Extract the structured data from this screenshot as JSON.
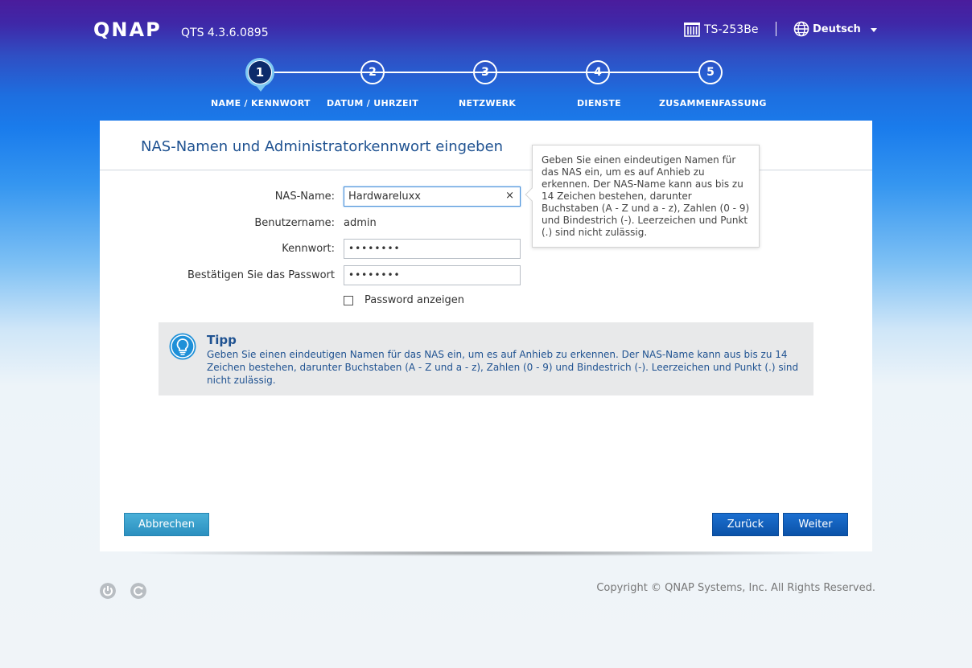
{
  "header": {
    "logo_text": "QNAP",
    "version": "QTS 4.3.6.0895",
    "model": "TS-253Be",
    "language": "Deutsch",
    "icons": {
      "nas": "nas-device-icon",
      "language": "globe-icon",
      "dropdown": "chevron-down-icon"
    }
  },
  "wizard": {
    "steps": [
      {
        "number": "1",
        "label": "NAME / KENNWORT",
        "active": true
      },
      {
        "number": "2",
        "label": "DATUM / UHRZEIT",
        "active": false
      },
      {
        "number": "3",
        "label": "NETZWERK",
        "active": false
      },
      {
        "number": "4",
        "label": "DIENSTE",
        "active": false
      },
      {
        "number": "5",
        "label": "ZUSAMMENFASSUNG",
        "active": false
      }
    ]
  },
  "panel": {
    "title": "NAS-Namen und Administratorkennwort eingeben",
    "form": {
      "nas_name_label": "NAS-Name:",
      "nas_name_value": "Hardwareluxx",
      "username_label": "Benutzername:",
      "username_value": "admin",
      "password_label": "Kennwort:",
      "password_value": "••••••••",
      "confirm_label": "Bestätigen Sie das Passwort",
      "confirm_value": "••••••••",
      "show_password_label": "Password anzeigen",
      "clear_symbol": "×"
    },
    "tooltip": "Geben Sie einen eindeutigen Namen für das NAS ein, um es auf Anhieb zu erkennen. Der NAS-Name kann aus bis zu 14 Zeichen bestehen, darunter Buchstaben (A - Z und a - z), Zahlen (0 - 9) und Bindestrich (-). Leerzeichen und Punkt (.) sind nicht zulässig.",
    "tip": {
      "title": "Tipp",
      "text": "Geben Sie einen eindeutigen Namen für das NAS ein, um es auf Anhieb zu erkennen. Der NAS-Name kann aus bis zu 14 Zeichen bestehen, darunter Buchstaben (A - Z und a - z), Zahlen (0 - 9) und Bindestrich (-). Leerzeichen und Punkt (.) sind nicht zulässig."
    },
    "buttons": {
      "cancel": "Abbrechen",
      "back": "Zurück",
      "next": "Weiter"
    }
  },
  "footer": {
    "copyright": "Copyright © QNAP Systems, Inc. All Rights Reserved.",
    "icons": [
      "power-icon",
      "restart-icon"
    ]
  },
  "colors": {
    "accent": "#1f5291",
    "primary_button": "#0b52a8",
    "secondary_button": "#2b8fbf"
  }
}
